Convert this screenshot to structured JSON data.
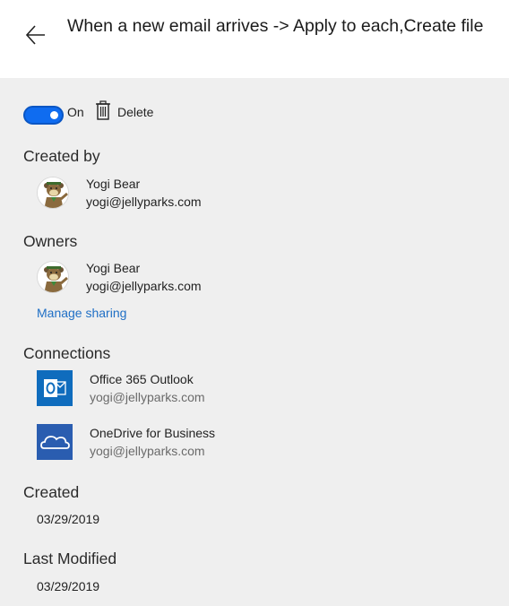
{
  "header": {
    "title": "When a new email arrives -> Apply to each,Create file"
  },
  "toolbar": {
    "toggle_label": "On",
    "delete_label": "Delete"
  },
  "created_by": {
    "heading": "Created by",
    "name": "Yogi Bear",
    "email": "yogi@jellyparks.com"
  },
  "owners": {
    "heading": "Owners",
    "items": [
      {
        "name": "Yogi Bear",
        "email": "yogi@jellyparks.com"
      }
    ],
    "manage_sharing": "Manage sharing"
  },
  "connections": {
    "heading": "Connections",
    "items": [
      {
        "name": "Office 365 Outlook",
        "account": "yogi@jellyparks.com",
        "icon": "outlook-icon",
        "color": "#0f6cbd"
      },
      {
        "name": "OneDrive for Business",
        "account": "yogi@jellyparks.com",
        "icon": "onedrive-icon",
        "color": "#2a5db0"
      }
    ]
  },
  "created": {
    "heading": "Created",
    "value": "03/29/2019"
  },
  "last_modified": {
    "heading": "Last Modified",
    "value": "03/29/2019"
  },
  "colors": {
    "accent": "#0f6cf0",
    "link": "#1f6fc5",
    "background": "#efefef"
  }
}
